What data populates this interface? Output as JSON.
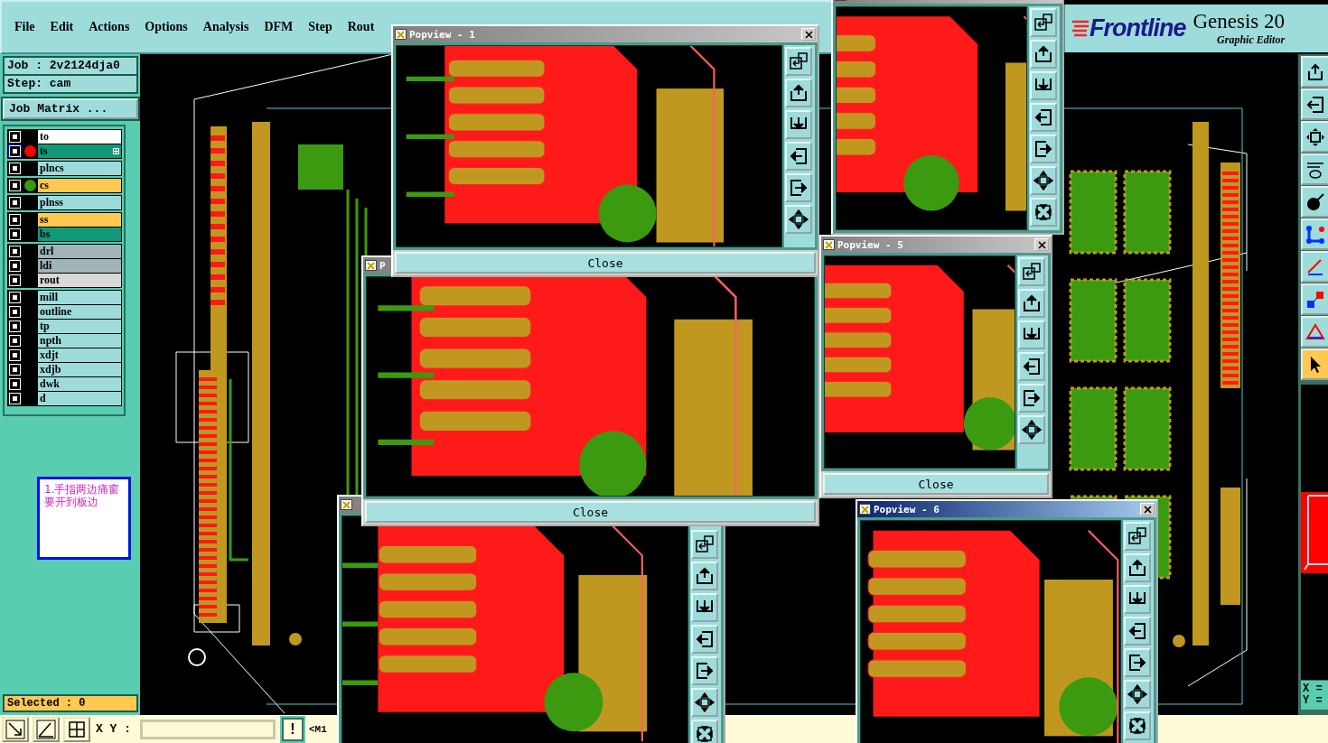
{
  "menu": [
    {
      "label": "File"
    },
    {
      "label": "Edit"
    },
    {
      "label": "Actions"
    },
    {
      "label": "Options"
    },
    {
      "label": "Analysis"
    },
    {
      "label": "DFM"
    },
    {
      "label": "Step"
    },
    {
      "label": "Rout"
    }
  ],
  "logo": {
    "brand": "Frontline",
    "product": "Genesis 20",
    "subtitle": "Graphic Editor"
  },
  "job": "Job : 2v2124dja0",
  "step": "Step: cam",
  "job_matrix_button": "Job Matrix ...",
  "layer_groups": [
    [
      {
        "name": "to",
        "color": "#ffffff",
        "checked": true,
        "focused": false
      },
      {
        "name": "ts",
        "color": "#109878",
        "marker": {
          "color": "#ff0000"
        },
        "checked": true,
        "focused": true
      }
    ],
    [
      {
        "name": "plncs",
        "color": "#9edcdc",
        "checked": true,
        "focused": false
      }
    ],
    [
      {
        "name": "cs",
        "color": "#ffc850",
        "marker": {
          "color": "#3c9a10"
        },
        "checked": true,
        "focused": false
      }
    ],
    [
      {
        "name": "plnss",
        "color": "#9edcdc",
        "checked": true,
        "focused": false
      }
    ],
    [
      {
        "name": "ss",
        "color": "#ffc850",
        "checked": true,
        "focused": false
      },
      {
        "name": "bs",
        "color": "#109878",
        "checked": true,
        "focused": false
      }
    ],
    [
      {
        "name": "drl",
        "color": "#a0b4b8",
        "checked": true,
        "focused": false
      },
      {
        "name": "ldi",
        "color": "#a0b4b8",
        "checked": true,
        "focused": false
      },
      {
        "name": "rout",
        "color": "#d8d8d8",
        "checked": true,
        "focused": false
      }
    ],
    [
      {
        "name": "mill",
        "color": "#9edcdc",
        "checked": true,
        "focused": false
      },
      {
        "name": "outline",
        "color": "#9edcdc",
        "checked": true,
        "focused": false
      },
      {
        "name": "tp",
        "color": "#9edcdc",
        "checked": true,
        "focused": false
      },
      {
        "name": "npth",
        "color": "#9edcdc",
        "checked": true,
        "focused": false
      },
      {
        "name": "xdjt",
        "color": "#9edcdc",
        "checked": true,
        "focused": false
      },
      {
        "name": "xdjb",
        "color": "#9edcdc",
        "checked": true,
        "focused": false
      },
      {
        "name": "dwk",
        "color": "#9edcdc",
        "checked": true,
        "focused": false
      },
      {
        "name": "d",
        "color": "#9edcdc",
        "checked": true,
        "focused": false
      }
    ]
  ],
  "note": "1.手指两边痛窗要开到板边",
  "selected_count": "Selected : 0",
  "right_tools": [
    {
      "kind": "raise",
      "selected": false
    },
    {
      "kind": "enter",
      "selected": false
    },
    {
      "kind": "fit",
      "selected": false
    },
    {
      "kind": "pen",
      "selected": false
    },
    {
      "kind": "dot",
      "selected": false
    },
    {
      "kind": "nodes",
      "selected": false
    },
    {
      "kind": "angle",
      "selected": false
    },
    {
      "kind": "move",
      "selected": false
    },
    {
      "kind": "triangle",
      "selected": false
    },
    {
      "kind": "pointer",
      "selected": true
    }
  ],
  "coords": [
    "X =",
    "Y ="
  ],
  "status_bar": {
    "xy_label": "X Y :",
    "exclaim_button": "!",
    "message": "<M1"
  },
  "popviews": [
    {
      "active": false
    },
    {
      "title": "P",
      "active": false,
      "close": "Close"
    },
    {
      "title": "Popview - 1",
      "active": false,
      "close": "Close"
    },
    {
      "active": false
    },
    {
      "title": "Popview - 5",
      "active": false,
      "close": "Close"
    },
    {
      "title": "Popview - 6",
      "active": true
    }
  ]
}
